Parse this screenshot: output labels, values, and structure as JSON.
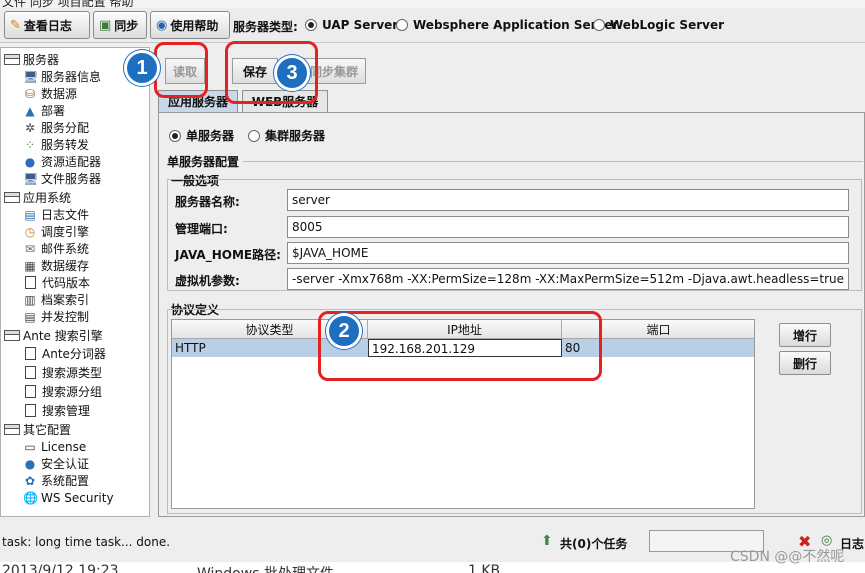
{
  "top_cut_text": "文件  同步  项目配置  帮助",
  "toolbar": {
    "view_log": "查看日志",
    "sync": "同步",
    "help": "使用帮助",
    "server_type_label": "服务器类型:",
    "server_types": [
      "UAP Server",
      "Websphere Application Server",
      "WebLogic Server"
    ],
    "selected_server_type": "UAP Server"
  },
  "tree": {
    "groups": [
      {
        "label": "服务器",
        "items": [
          {
            "icon": "monitor-icon",
            "label": "服务器信息"
          },
          {
            "icon": "datasource-icon",
            "label": "数据源"
          },
          {
            "icon": "deploy-icon",
            "label": "部署"
          },
          {
            "icon": "distribution-icon",
            "label": "服务分配"
          },
          {
            "icon": "forward-icon",
            "label": "服务转发"
          },
          {
            "icon": "adapter-icon",
            "label": "资源适配器"
          },
          {
            "icon": "file-server-icon",
            "label": "文件服务器"
          }
        ]
      },
      {
        "label": "应用系统",
        "items": [
          {
            "icon": "log-file-icon",
            "label": "日志文件"
          },
          {
            "icon": "clock-icon",
            "label": "调度引擎"
          },
          {
            "icon": "mail-icon",
            "label": "邮件系统"
          },
          {
            "icon": "cache-icon",
            "label": "数据缓存"
          },
          {
            "icon": "doc-icon",
            "label": "代码版本"
          },
          {
            "icon": "index-icon",
            "label": "档案索引"
          },
          {
            "icon": "concurrency-icon",
            "label": "并发控制"
          }
        ]
      },
      {
        "label": "Ante 搜索引擎",
        "items": [
          {
            "icon": "doc-icon",
            "label": "Ante分词器"
          },
          {
            "icon": "doc-icon",
            "label": "搜索源类型"
          },
          {
            "icon": "doc-icon",
            "label": "搜索源分组"
          },
          {
            "icon": "doc-icon",
            "label": "搜索管理"
          }
        ]
      },
      {
        "label": "其它配置",
        "items": [
          {
            "icon": "license-icon",
            "label": "License"
          },
          {
            "icon": "security-icon",
            "label": "安全认证"
          },
          {
            "icon": "config-icon",
            "label": "系统配置"
          },
          {
            "icon": "ws-security-icon",
            "label": "WS Security"
          }
        ]
      }
    ]
  },
  "actions": {
    "read": "读取",
    "save": "保存",
    "cluster": "同步集群"
  },
  "tabs": {
    "app_server": "应用服务器",
    "web_server": "WEB服务器"
  },
  "mode": {
    "single": "单服务器",
    "cluster": "集群服务器",
    "selected": "单服务器"
  },
  "config": {
    "section_title": "单服务器配置",
    "general_title": "一般选项",
    "fields": [
      {
        "label": "服务器名称:",
        "value": "server"
      },
      {
        "label": "管理端口:",
        "value": "8005"
      },
      {
        "label": "JAVA_HOME路径:",
        "value": "$JAVA_HOME"
      },
      {
        "label": "虚拟机参数:",
        "value": "-server -Xmx768m -XX:PermSize=128m -XX:MaxPermSize=512m -Djava.awt.headless=true -Dfile.encoding"
      }
    ]
  },
  "protocol": {
    "title": "协议定义",
    "columns": [
      "协议类型",
      "IP地址",
      "端口"
    ],
    "rows": [
      {
        "type": "HTTP",
        "ip": "192.168.201.129",
        "port": "80"
      }
    ],
    "add_row": "增行",
    "delete_row": "删行"
  },
  "annotations": [
    "1",
    "2",
    "3"
  ],
  "status": {
    "message": "task: long time task... done.",
    "tasks": "共(0)个任务",
    "log": "日志"
  },
  "bottom_cut": {
    "date": "2013/9/12 19:23",
    "type": "Windows 批处理文件",
    "size": "1 KB"
  },
  "watermark": "CSDN @@不然呢",
  "colors": {
    "annotation_circle": "#1f6fc0",
    "annotation_box": "#e52222",
    "selected_row": "#b8cfe5"
  }
}
